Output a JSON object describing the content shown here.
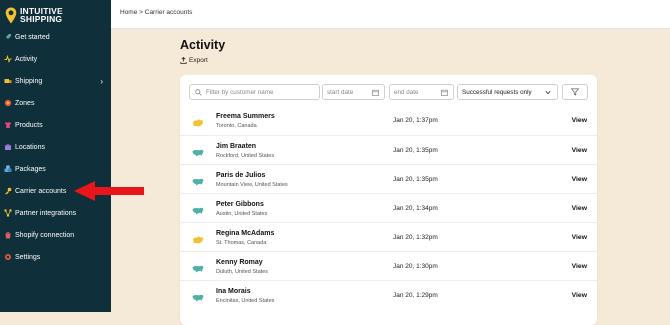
{
  "brand": {
    "line1": "INTUITIVE",
    "line2": "SHIPPING"
  },
  "sidebar": {
    "items": [
      {
        "label": "Get started",
        "icon": "rocket-icon"
      },
      {
        "label": "Activity",
        "icon": "activity-icon"
      },
      {
        "label": "Shipping",
        "icon": "shipping-icon",
        "has_submenu": true
      },
      {
        "label": "Zones",
        "icon": "zones-icon"
      },
      {
        "label": "Products",
        "icon": "products-icon"
      },
      {
        "label": "Locations",
        "icon": "locations-icon"
      },
      {
        "label": "Packages",
        "icon": "packages-icon"
      },
      {
        "label": "Carrier accounts",
        "icon": "key-icon"
      },
      {
        "label": "Partner integrations",
        "icon": "integrations-icon"
      },
      {
        "label": "Shopify connection",
        "icon": "shopify-icon"
      },
      {
        "label": "Settings",
        "icon": "gear-icon"
      }
    ]
  },
  "breadcrumb": "Home > Carrier accounts",
  "page": {
    "title": "Activity",
    "export_label": "Export"
  },
  "filters": {
    "search_placeholder": "Filter by customer name",
    "start_date_placeholder": "start date",
    "end_date_placeholder": "end date",
    "status_value": "Successful requests only"
  },
  "rows": [
    {
      "name": "Freema Summers",
      "location": "Toronto, Canada",
      "date": "Jan 20, 1:37pm",
      "action": "View",
      "country": "CA"
    },
    {
      "name": "Jim Braaten",
      "location": "Rockford, United States",
      "date": "Jan 20, 1:35pm",
      "action": "View",
      "country": "US"
    },
    {
      "name": "Paris de Julios",
      "location": "Mountain View, United States",
      "date": "Jan 20, 1:35pm",
      "action": "View",
      "country": "US"
    },
    {
      "name": "Peter Gibbons",
      "location": "Austin, United States",
      "date": "Jan 20, 1:34pm",
      "action": "View",
      "country": "US"
    },
    {
      "name": "Regina McAdams",
      "location": "St. Thomas, Canada",
      "date": "Jan 20, 1:32pm",
      "action": "View",
      "country": "CA"
    },
    {
      "name": "Kenny Romay",
      "location": "Duluth, United States",
      "date": "Jan 20, 1:30pm",
      "action": "View",
      "country": "US"
    },
    {
      "name": "Ina Morais",
      "location": "Encinitas, United States",
      "date": "Jan 20, 1:29pm",
      "action": "View",
      "country": "US"
    }
  ],
  "colors": {
    "sidebar_bg": "#0f2f3a",
    "page_bg": "#f5ead7",
    "accent_yellow": "#f2c230",
    "us_map": "#4fb1a4",
    "annotation_arrow": "#e8161b"
  }
}
